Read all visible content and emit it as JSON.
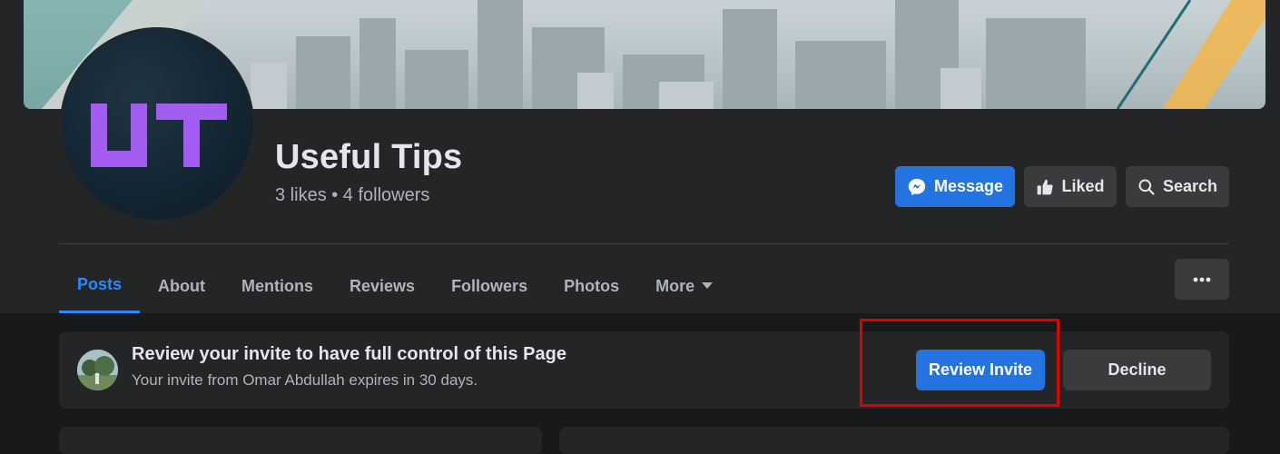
{
  "page": {
    "name": "Useful Tips",
    "stats": "3 likes • 4 followers",
    "avatar_text": "UT"
  },
  "actions": {
    "message": "Message",
    "liked": "Liked",
    "search": "Search"
  },
  "tabs": [
    {
      "label": "Posts",
      "active": true
    },
    {
      "label": "About"
    },
    {
      "label": "Mentions"
    },
    {
      "label": "Reviews"
    },
    {
      "label": "Followers"
    },
    {
      "label": "Photos"
    },
    {
      "label": "More"
    }
  ],
  "invite": {
    "title": "Review your invite to have full control of this Page",
    "subtitle": "Your invite from Omar Abdullah expires in 30 days.",
    "review_label": "Review Invite",
    "decline_label": "Decline"
  },
  "colors": {
    "background": "#18191a",
    "surface": "#242526",
    "primary": "#2374e1",
    "active_tab": "#2d88ff",
    "avatar_letters": "#a25cf0",
    "highlight": "#e00000"
  }
}
